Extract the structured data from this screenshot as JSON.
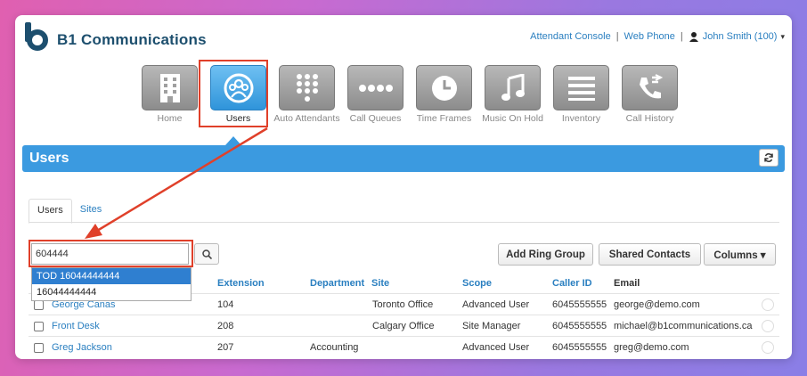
{
  "brand": {
    "name": "B1 Communications",
    "logo_letter": "b"
  },
  "top_links": {
    "attendant_console": "Attendant Console",
    "separator": "|",
    "web_phone": "Web Phone",
    "user_name": "John Smith (100)",
    "user_caret": "▾"
  },
  "nav": [
    {
      "label": "Home",
      "icon": "building-icon"
    },
    {
      "label": "Users",
      "icon": "users-icon",
      "active": true
    },
    {
      "label": "Auto Attendants",
      "icon": "keypad-icon"
    },
    {
      "label": "Call Queues",
      "icon": "dots-icon"
    },
    {
      "label": "Time Frames",
      "icon": "clock-icon"
    },
    {
      "label": "Music On Hold",
      "icon": "music-icon"
    },
    {
      "label": "Inventory",
      "icon": "list-icon"
    },
    {
      "label": "Call History",
      "icon": "call-history-icon"
    }
  ],
  "section": {
    "title": "Users"
  },
  "tabs": {
    "users": "Users",
    "sites": "Sites"
  },
  "search": {
    "value": "604444"
  },
  "autocomplete": [
    "TOD 16044444444",
    "16044444444"
  ],
  "buttons": {
    "add_ring_group": "Add Ring Group",
    "shared_contacts": "Shared Contacts",
    "columns": "Columns ▾"
  },
  "table": {
    "headers": {
      "extension": "Extension",
      "department": "Department",
      "site": "Site",
      "scope": "Scope",
      "caller_id": "Caller ID",
      "email": "Email"
    },
    "rows": [
      {
        "name": "George Canas",
        "extension": "104",
        "department": "",
        "site": "Toronto Office",
        "scope": "Advanced User",
        "caller_id": "6045555555",
        "email": "george@demo.com"
      },
      {
        "name": "Front Desk",
        "extension": "208",
        "department": "",
        "site": "Calgary Office",
        "scope": "Site Manager",
        "caller_id": "6045555555",
        "email": "michael@b1communications.ca"
      },
      {
        "name": "Greg Jackson",
        "extension": "207",
        "department": "Accounting",
        "site": "",
        "scope": "Advanced User",
        "caller_id": "6045555555",
        "email": "greg@demo.com"
      }
    ]
  },
  "colors": {
    "accent": "#3b9ae0",
    "highlight": "#e0402a",
    "link": "#2a7fc0"
  }
}
